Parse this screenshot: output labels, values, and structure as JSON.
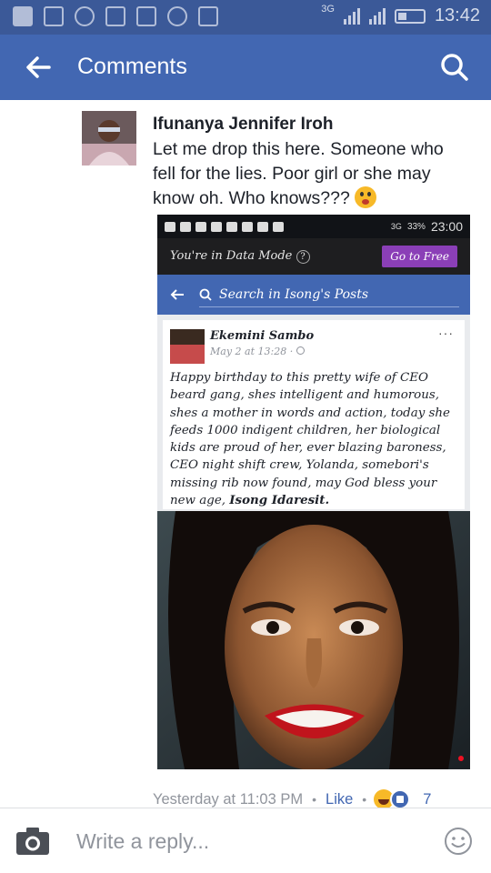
{
  "status_bar": {
    "network": "3G",
    "time": "13:42",
    "icons": [
      "facebook-icon",
      "gallery-icon",
      "messenger-dots-icon",
      "download-icon",
      "alert-icon",
      "messenger-icon",
      "video-icon",
      "signal-icon",
      "battery-icon"
    ]
  },
  "app_bar": {
    "title": "Comments"
  },
  "comment": {
    "author": "Ifunanya Jennifer Iroh",
    "text": "Let me drop this here. Someone who fell for the lies. Poor girl or she may know oh. Who knows???",
    "emoji": "astonished-face-emoji",
    "timestamp": "Yesterday at 11:03 PM",
    "like_label": "Like",
    "reaction_count": "7"
  },
  "embedded_screenshot": {
    "status": {
      "network": "3G",
      "battery": "33%",
      "time": "23:00"
    },
    "data_mode_text": "You're in Data Mode",
    "data_mode_help": "?",
    "go_free_label": "Go to Free",
    "search_placeholder": "Search in Isong's Posts",
    "post": {
      "author": "Ekemini Sambo",
      "date": "May 2 at 13:28",
      "menu": "···",
      "body": "Happy birthday to this pretty wife of CEO beard gang, shes intelligent and humorous, shes a mother in words and action, today she feeds 1000 indigent children, her biological kids are proud of her, ever blazing baroness, CEO night shift crew, Yolanda, somebori's missing rib now found, may God bless your new age, ",
      "tag": "Isong Idaresit."
    }
  },
  "composer": {
    "placeholder": "Write a reply..."
  },
  "colors": {
    "facebook_blue": "#4267b2",
    "status_bar": "#3b5998",
    "go_free_purple": "#8b3fb7",
    "meta_gray": "#90949c"
  }
}
